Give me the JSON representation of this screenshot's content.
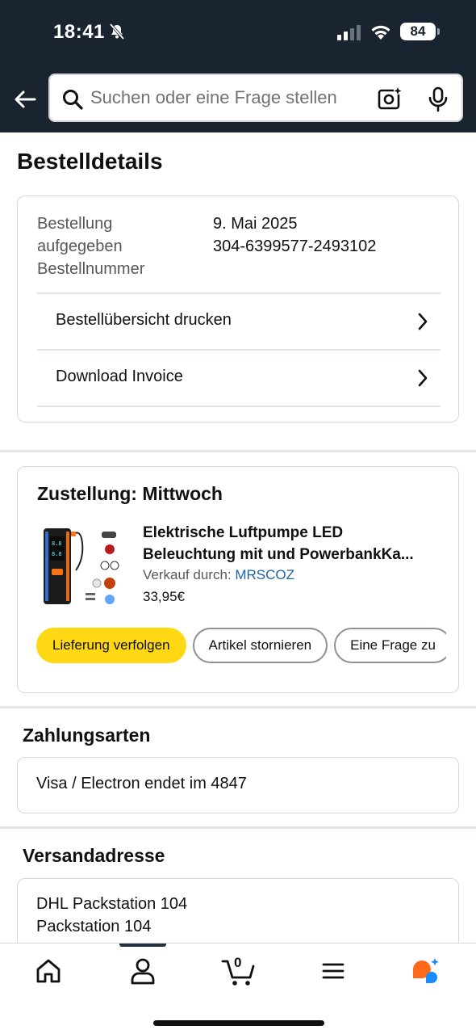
{
  "status_bar": {
    "time": "18:41",
    "battery": "84"
  },
  "search": {
    "placeholder": "Suchen oder eine Frage stellen"
  },
  "page": {
    "title": "Bestelldetails"
  },
  "order_info": {
    "label_placed": "Bestellung aufgegeben",
    "label_number": "Bestellnummer",
    "date": "9. Mai 2025",
    "number": "304-6399577-2493102",
    "rows": [
      {
        "label": "Bestellübersicht drucken"
      },
      {
        "label": "Download Invoice"
      }
    ]
  },
  "shipment": {
    "title": "Zustellung: Mittwoch",
    "product": {
      "name_line1": "Elektrische Luftpumpe LED",
      "name_line2": "Beleuchtung mit und PowerbankKa...",
      "seller_prefix": "Verkauf durch:",
      "seller": "MRSCOZ",
      "price": "33,95€"
    },
    "buttons": {
      "track": "Lieferung verfolgen",
      "cancel": "Artikel stornieren",
      "ask": "Eine Frage zu"
    }
  },
  "payment": {
    "title": "Zahlungsarten",
    "method": "Visa / Electron  endet im 4847"
  },
  "address": {
    "title": "Versandadresse",
    "line1": "DHL Packstation 104",
    "line2": "Packstation 104"
  },
  "bottom_nav": {
    "cart_count": "0",
    "items": [
      "home-icon",
      "account-icon",
      "cart-icon",
      "menu-icon",
      "rufus-icon"
    ]
  },
  "colors": {
    "header_bg": "#1a2330",
    "primary_button": "#ffd814",
    "link": "#2162a1",
    "rufus_orange": "#ff6a1a",
    "rufus_blue": "#1a8cff"
  }
}
